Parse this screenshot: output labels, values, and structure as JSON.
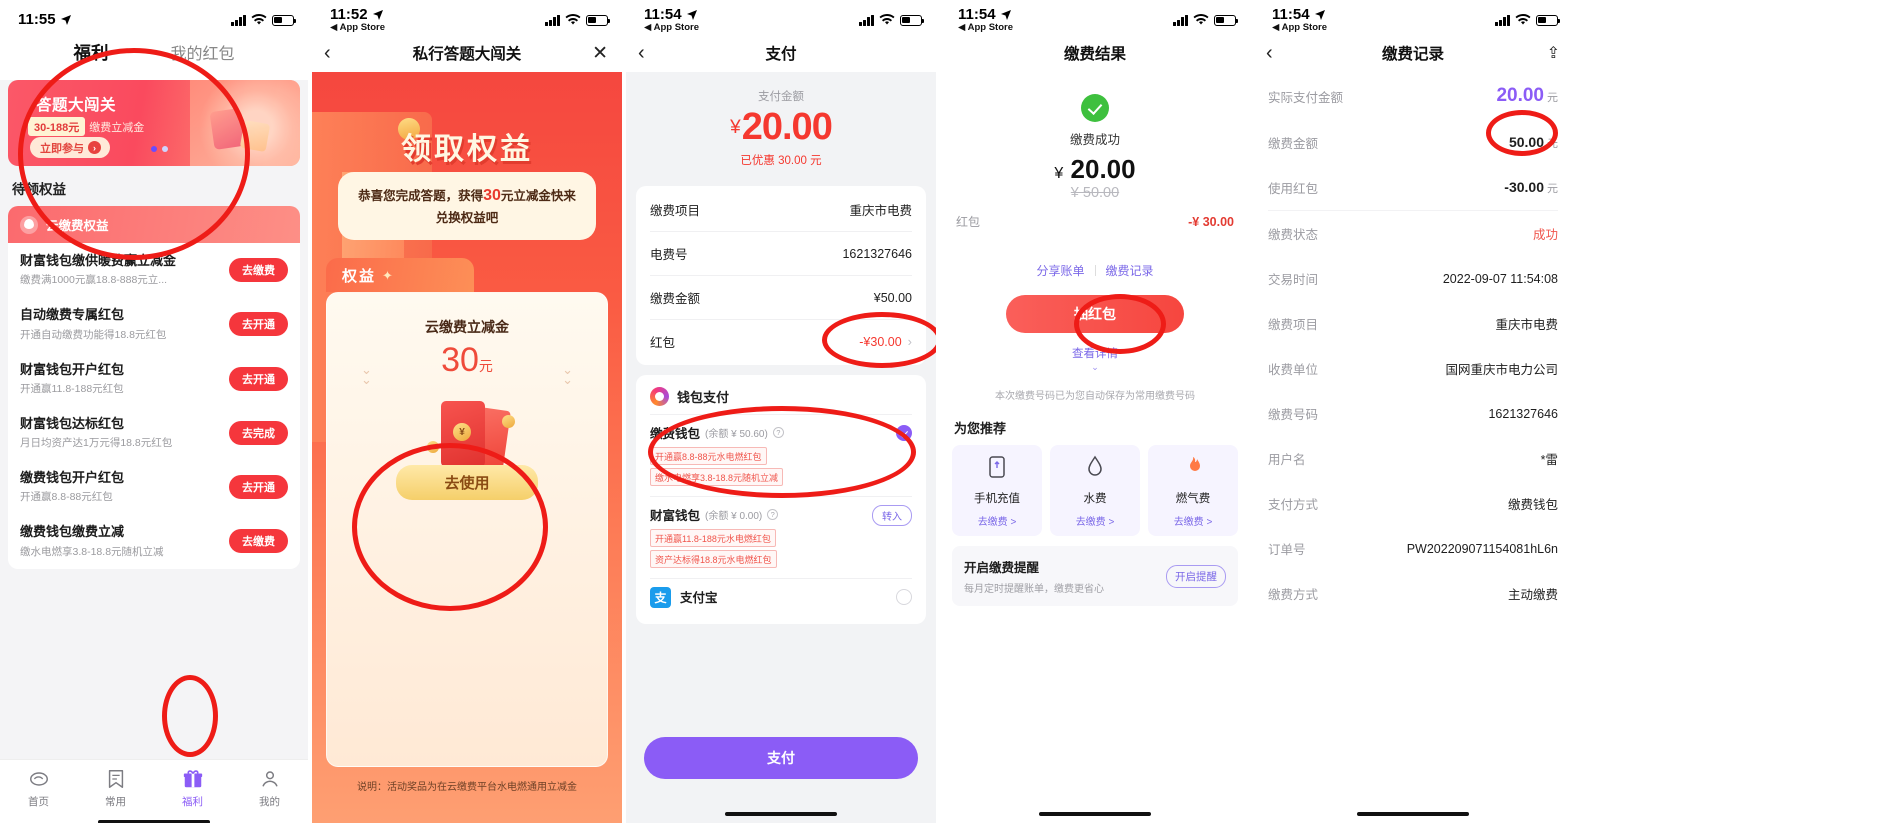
{
  "panel1": {
    "status": {
      "time": "11:55",
      "battery": "42"
    },
    "tabs": [
      {
        "label": "福利",
        "active": true
      },
      {
        "label": "我的红包",
        "active": false
      }
    ],
    "banner": {
      "title": "答题大闯关",
      "pill": "30-188元",
      "subtitle": "缴费立减金",
      "button": "立即参与",
      "arrow": "›"
    },
    "section_title": "待领权益",
    "card_header": "云缴费权益",
    "items": [
      {
        "title": "财富钱包缴供暖费赢立减金",
        "sub": "缴费满1000元赢18.8-888元立...",
        "action": "去缴费"
      },
      {
        "title": "自动缴费专属红包",
        "sub": "开通自动缴费功能得18.8元红包",
        "action": "去开通"
      },
      {
        "title": "财富钱包开户红包",
        "sub": "开通赢11.8-188元红包",
        "action": "去开通"
      },
      {
        "title": "财富钱包达标红包",
        "sub": "月日均资产达1万元得18.8元红包",
        "action": "去完成"
      },
      {
        "title": "缴费钱包开户红包",
        "sub": "开通赢8.8-88元红包",
        "action": "去开通"
      },
      {
        "title": "缴费钱包缴费立减",
        "sub": "缴水电燃享3.8-18.8元随机立减",
        "action": "去缴费"
      }
    ],
    "tabbar": [
      {
        "label": "首页",
        "icon": "home-icon",
        "active": false
      },
      {
        "label": "常用",
        "icon": "bookmark-icon",
        "active": false
      },
      {
        "label": "福利",
        "icon": "gift-icon",
        "active": true
      },
      {
        "label": "我的",
        "icon": "person-icon",
        "active": false
      }
    ]
  },
  "panel2": {
    "status": {
      "time": "11:52",
      "back_app": "◀ App Store"
    },
    "nav": {
      "back": "‹",
      "title": "私行答题大闯关",
      "close": "✕"
    },
    "hero_title": "领取权益",
    "bubble_pre": "恭喜您完成答题，获得",
    "bubble_amt": "30",
    "bubble_post": "元立减金快来兑换权益吧",
    "tag": "权益",
    "coupon_name": "云缴费立减金",
    "coupon_amount": "30",
    "coupon_unit": "元",
    "use_button": "去使用",
    "note": "说明：活动奖品为在云缴费平台水电燃通用立减金"
  },
  "panel3": {
    "status": {
      "time": "11:54",
      "back_app": "◀ App Store"
    },
    "nav": {
      "back": "‹",
      "title": "支付"
    },
    "amount_label": "支付金额",
    "amount_symbol": "¥",
    "amount": "20.00",
    "discount_text": "已优惠 30.00 元",
    "details": [
      {
        "key": "缴费项目",
        "value": "重庆市电费"
      },
      {
        "key": "电费号",
        "value": "1621327646"
      },
      {
        "key": "缴费金额",
        "value": "¥50.00"
      },
      {
        "key": "红包",
        "value": "-¥30.00",
        "arrow": "›",
        "highlight": true
      }
    ],
    "pay_section_title": "钱包支付",
    "methods": [
      {
        "name": "缴费钱包",
        "balance": "(余额 ¥ 50.60)",
        "tags": [
          "开通赢8.8-88元水电燃红包",
          "缴水电燃享3.8-18.8元随机立减"
        ],
        "selected": true,
        "action": ""
      },
      {
        "name": "财富钱包",
        "balance": "(余额 ¥ 0.00)",
        "tags": [
          "开通赢11.8-188元水电燃红包",
          "资产达标得18.8元水电燃红包"
        ],
        "selected": false,
        "action": "转入"
      },
      {
        "name": "支付宝",
        "balance": "",
        "tags": [],
        "selected": false,
        "action": ""
      }
    ],
    "pay_button": "支付"
  },
  "panel4": {
    "status": {
      "time": "11:54",
      "back_app": "◀ App Store"
    },
    "nav": {
      "title": "缴费结果"
    },
    "status_text": "缴费成功",
    "amount_symbol": "¥",
    "amount": "20.00",
    "original_amount": "¥ 50.00",
    "redpacket_key": "红包",
    "redpacket_value": "-¥ 30.00",
    "links": [
      {
        "label": "分享账单"
      },
      {
        "label": "缴费记录"
      }
    ],
    "draw_button": "抽红包",
    "detail_link": "查看详情",
    "detail_chevron": "⌄",
    "tip": "本次缴费号码已为您自动保存为常用缴费号码",
    "recommend_title": "为您推荐",
    "recommends": [
      {
        "name": "手机充值",
        "icon": "phone-icon",
        "action": "去缴费 >"
      },
      {
        "name": "水费",
        "icon": "water-drop-icon",
        "action": "去缴费 >"
      },
      {
        "name": "燃气费",
        "icon": "flame-icon",
        "action": "去缴费 >"
      }
    ],
    "remind": {
      "title": "开启缴费提醒",
      "sub": "每月定时提醒账单，缴费更省心",
      "button": "开启提醒"
    }
  },
  "panel5": {
    "status": {
      "time": "11:54",
      "back_app": "◀ App Store"
    },
    "nav": {
      "back": "‹",
      "title": "缴费记录",
      "share": "⇪"
    },
    "rows": [
      {
        "key": "实际支付金额",
        "value": "20.00",
        "unit": "元",
        "style": "big"
      },
      {
        "key": "缴费金额",
        "value": "50.00",
        "unit": "元",
        "style": "amt"
      },
      {
        "key": "使用红包",
        "value": "-30.00",
        "unit": "元",
        "style": "amt"
      },
      {
        "key": "缴费状态",
        "value": "成功",
        "unit": "",
        "style": "ok"
      },
      {
        "key": "交易时间",
        "value": "2022-09-07 11:54:08",
        "unit": "",
        "style": ""
      },
      {
        "key": "缴费项目",
        "value": "重庆市电费",
        "unit": "",
        "style": ""
      },
      {
        "key": "收费单位",
        "value": "国网重庆市电力公司",
        "unit": "",
        "style": ""
      },
      {
        "key": "缴费号码",
        "value": "1621327646",
        "unit": "",
        "style": ""
      },
      {
        "key": "用户名",
        "value": "*雷",
        "unit": "",
        "style": ""
      },
      {
        "key": "支付方式",
        "value": "缴费钱包",
        "unit": "",
        "style": ""
      },
      {
        "key": "订单号",
        "value": "PW202209071154081hL6n",
        "unit": "",
        "style": ""
      },
      {
        "key": "缴费方式",
        "value": "主动缴费",
        "unit": "",
        "style": ""
      }
    ]
  }
}
